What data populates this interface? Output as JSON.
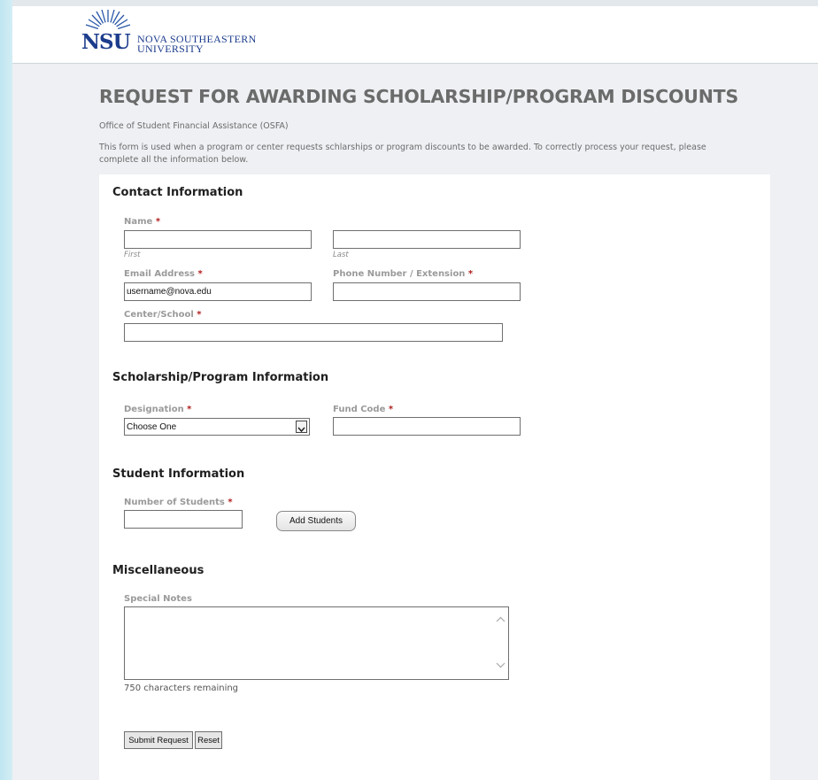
{
  "logo": {
    "acronym": "NSU",
    "line1": "NOVA SOUTHEASTERN",
    "line2": "UNIVERSITY",
    "brand_color": "#1c3c8c"
  },
  "title": "REQUEST FOR AWARDING SCHOLARSHIP/PROGRAM DISCOUNTS",
  "office": "Office of Student Financial Assistance (OSFA)",
  "intro": "This form is used when a program or center requests schlarships or program discounts to be awarded. To correctly process your request, please complete all the information below.",
  "required_marker": "*",
  "contact": {
    "heading": "Contact Information",
    "name_label": "Name",
    "first_sublabel": "First",
    "last_sublabel": "Last",
    "first_value": "",
    "last_value": "",
    "email_label": "Email Address",
    "email_value": "username@nova.edu",
    "phone_label": "Phone Number / Extension",
    "phone_value": "",
    "center_label": "Center/School",
    "center_value": ""
  },
  "scholarship": {
    "heading": "Scholarship/Program Information",
    "designation_label": "Designation",
    "designation_selected": "Choose One",
    "fund_code_label": "Fund Code",
    "fund_code_value": ""
  },
  "student": {
    "heading": "Student Information",
    "count_label": "Number of Students",
    "count_value": "",
    "add_button": "Add Students"
  },
  "misc": {
    "heading": "Miscellaneous",
    "notes_label": "Special Notes",
    "notes_value": "",
    "chars_remaining": "750 characters remaining"
  },
  "actions": {
    "submit": "Submit Request",
    "reset": "Reset"
  },
  "colors": {
    "required": "#b01e1e",
    "label": "#9a9a9a",
    "title": "#6b6b6b"
  },
  "icons": [
    "sunburst-logo-icon",
    "chevron-down-icon",
    "scroll-up-arrow-icon",
    "scroll-down-arrow-icon"
  ]
}
